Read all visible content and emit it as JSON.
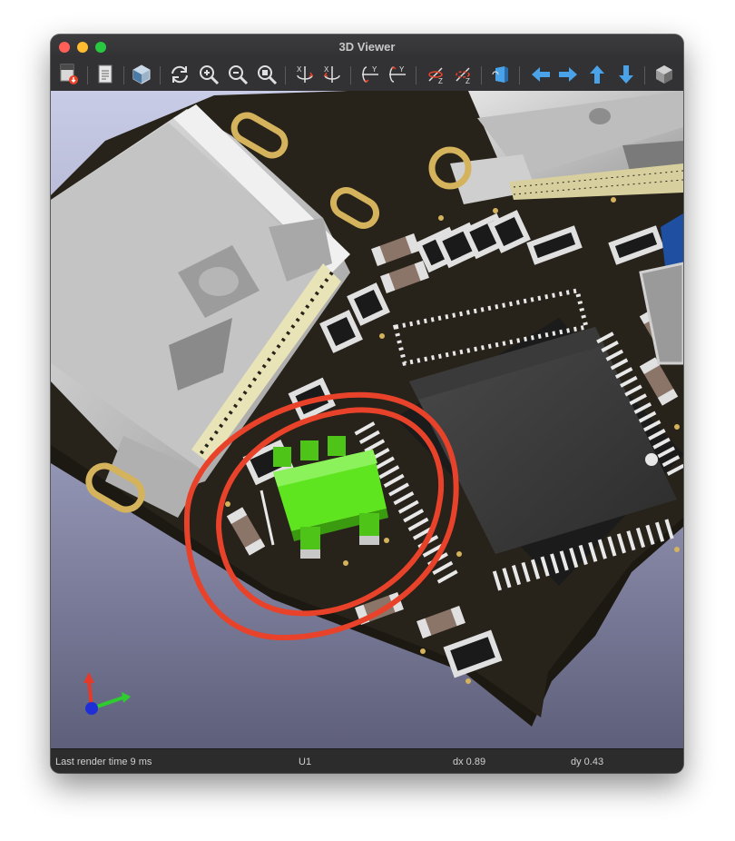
{
  "window": {
    "title": "3D Viewer"
  },
  "toolbar": {
    "tools": [
      {
        "name": "export-image-button",
        "icon": "export-image-icon"
      },
      {
        "name": "copy-to-clipboard-button",
        "icon": "clipboard-icon"
      },
      {
        "name": "render-mode-button",
        "icon": "cube-render-icon"
      },
      {
        "name": "reload-board-button",
        "icon": "refresh-icon"
      },
      {
        "name": "zoom-in-button",
        "icon": "zoom-in-icon"
      },
      {
        "name": "zoom-out-button",
        "icon": "zoom-out-icon"
      },
      {
        "name": "zoom-fit-button",
        "icon": "zoom-fit-icon"
      },
      {
        "name": "rotate-x-cw-button",
        "icon": "rotate-x-cw-icon",
        "label": "X"
      },
      {
        "name": "rotate-x-ccw-button",
        "icon": "rotate-x-ccw-icon",
        "label": "X"
      },
      {
        "name": "rotate-y-cw-button",
        "icon": "rotate-y-cw-icon",
        "label": "Y"
      },
      {
        "name": "rotate-y-ccw-button",
        "icon": "rotate-y-ccw-icon",
        "label": "Y"
      },
      {
        "name": "rotate-z-cw-button",
        "icon": "rotate-z-cw-icon",
        "label": "Z"
      },
      {
        "name": "rotate-z-ccw-button",
        "icon": "rotate-z-ccw-icon",
        "label": "Z"
      },
      {
        "name": "flip-board-button",
        "icon": "flip-board-icon"
      },
      {
        "name": "pan-left-button",
        "icon": "arrow-left-icon"
      },
      {
        "name": "pan-right-button",
        "icon": "arrow-right-icon"
      },
      {
        "name": "pan-up-button",
        "icon": "arrow-up-icon"
      },
      {
        "name": "pan-down-button",
        "icon": "arrow-down-icon"
      },
      {
        "name": "ortho-view-button",
        "icon": "cube-ortho-icon"
      }
    ]
  },
  "status": {
    "render_time": "Last render time 9 ms",
    "selected": "U1",
    "dx": "dx 0.89",
    "dy": "dy 0.43"
  },
  "colors": {
    "background_top": "#c9cce6",
    "background_bottom": "#5e5f7a",
    "board": "#27221a",
    "pad_gold": "#d4b35c",
    "highlight_green": "#5fe51f",
    "annotation_red": "#e8432a",
    "accent_blue": "#4aa3e8"
  }
}
